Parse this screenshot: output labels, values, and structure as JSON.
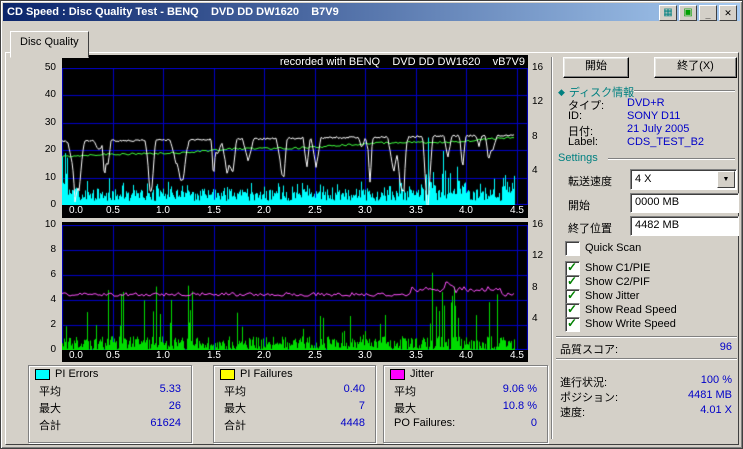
{
  "window": {
    "title": "CD Speed : Disc Quality Test - BENQ    DVD DD DW1620    B7V9"
  },
  "titlebar": {
    "chart_icon": "chart",
    "save_icon": "save",
    "minimize": "_",
    "close": "✕"
  },
  "tab": {
    "label": "Disc Quality"
  },
  "charts": {
    "header": "recorded with BENQ    DVD DD DW1620    vB7V9",
    "x_ticks": [
      "0.0",
      "0.5",
      "1.0",
      "1.5",
      "2.0",
      "2.5",
      "3.0",
      "3.5",
      "4.0",
      "4.5"
    ],
    "top": {
      "left_ticks": [
        50,
        40,
        30,
        20,
        10,
        0
      ],
      "right_ticks": [
        16,
        12,
        8,
        4
      ]
    },
    "bottom": {
      "left_ticks": [
        10,
        8,
        6,
        4,
        2,
        0
      ],
      "right_ticks": [
        16,
        12,
        8,
        4
      ]
    },
    "colors": {
      "grid": "#0000C8",
      "pie": "#00FFFF",
      "pif": "#00DC00",
      "jitter": "#FF50FF",
      "read_speed": "#FFFFFF",
      "write_speed": "#40FF40"
    }
  },
  "chart_data": [
    {
      "type": "area",
      "position": "top",
      "x_unit": "GB",
      "x_range": [
        0,
        4.6
      ],
      "x_ticks": [
        "0.0",
        "0.5",
        "1.0",
        "1.5",
        "2.0",
        "2.5",
        "3.0",
        "3.5",
        "4.0",
        "4.5"
      ],
      "left_axis": {
        "range": [
          0,
          50
        ],
        "ticks": [
          50,
          40,
          30,
          20,
          10,
          0
        ]
      },
      "right_axis": {
        "ticks": [
          16,
          12,
          8,
          4
        ]
      },
      "annotation": "recorded with BENQ    DVD DD DW1620    vB7V9",
      "series": [
        {
          "name": "PI Errors (C1/PIE)",
          "color": "#00FFFF",
          "style": "vertical-spikes",
          "average": 5.33,
          "maximum": 26,
          "total": 61624,
          "shape": "dense spikes mostly 2-8 on 0-50 scale, taller cluster up to ~26 between 3.6 and 4.0 GB, tall burst at 0 GB"
        },
        {
          "name": "Write Speed",
          "color": "#40FF40",
          "style": "line",
          "shape": "rises steadily from ~17 to ~24 on the 0-50 left scale"
        },
        {
          "name": "Read Speed",
          "color": "#FFFFFF",
          "style": "line",
          "shape": "~23-25 with frequent narrow downward dips, deepest near 3.6 GB"
        }
      ]
    },
    {
      "type": "area",
      "position": "bottom",
      "x_unit": "GB",
      "x_range": [
        0,
        4.6
      ],
      "x_ticks": [
        "0.0",
        "0.5",
        "1.0",
        "1.5",
        "2.0",
        "2.5",
        "3.0",
        "3.5",
        "4.0",
        "4.5"
      ],
      "left_axis": {
        "range": [
          0,
          10
        ],
        "ticks": [
          10,
          8,
          6,
          4,
          2,
          0
        ]
      },
      "right_axis": {
        "ticks": [
          16,
          12,
          8,
          4
        ]
      },
      "series": [
        {
          "name": "PI Failures (C2/PIF)",
          "color": "#00DC00",
          "style": "vertical-spikes",
          "average": 0.4,
          "maximum": 7,
          "total": 4448,
          "shape": "dense spikes 0-4, taller group near 0-1.3 GB and 3.5-4.1 GB reaching ~7"
        },
        {
          "name": "Jitter",
          "color": "#FF50FF",
          "style": "line",
          "average": "9.06 %",
          "maximum": "10.8 %",
          "shape": "noisy line around 4.5 on the 0-10 scale, peaks ~5.4 near 3.8 GB"
        }
      ]
    }
  ],
  "legend": {
    "pi_errors": {
      "title": "PI Errors",
      "swatch": "#00FFFF",
      "rows": [
        {
          "label": "平均",
          "value": "5.33"
        },
        {
          "label": "最大",
          "value": "26"
        },
        {
          "label": "合計",
          "value": "61624"
        }
      ]
    },
    "pi_failures": {
      "title": "PI Failures",
      "swatch": "#FFFF00",
      "rows": [
        {
          "label": "平均",
          "value": "0.40"
        },
        {
          "label": "最大",
          "value": "7"
        },
        {
          "label": "合計",
          "value": "4448"
        }
      ]
    },
    "jitter": {
      "title": "Jitter",
      "swatch": "#FF00FF",
      "rows": [
        {
          "label": "平均",
          "value": "9.06 %"
        },
        {
          "label": "最大",
          "value": "10.8 %"
        },
        {
          "label": "PO Failures:",
          "value": "0"
        }
      ]
    }
  },
  "side": {
    "start_button": "開始",
    "exit_button": "終了(X)",
    "disc_info": {
      "header": "ディスク情報",
      "rows": [
        {
          "label": "タイプ:",
          "value": "DVD+R"
        },
        {
          "label": "ID:",
          "value": "SONY D11"
        },
        {
          "label": "日付:",
          "value": "21 July 2005"
        },
        {
          "label": "Label:",
          "value": "CDS_TEST_B2"
        }
      ]
    },
    "settings": {
      "header": "Settings",
      "transfer_rate_label": "転送速度",
      "transfer_rate_value": "4 X",
      "start_label": "開始",
      "start_value": "0000 MB",
      "end_label": "終了位置",
      "end_value": "4482 MB",
      "checkboxes": [
        {
          "label": "Quick Scan",
          "checked": false
        },
        {
          "label": "Show C1/PIE",
          "checked": true
        },
        {
          "label": "Show C2/PIF",
          "checked": true
        },
        {
          "label": "Show Jitter",
          "checked": true
        },
        {
          "label": "Show Read Speed",
          "checked": true
        },
        {
          "label": "Show Write Speed",
          "checked": true
        }
      ]
    },
    "score": {
      "label": "品質スコア:",
      "value": "96"
    },
    "status": [
      {
        "label": "進行状況:",
        "value": "100 %"
      },
      {
        "label": "ポジション:",
        "value": "4481 MB"
      },
      {
        "label": "速度:",
        "value": "4.01 X"
      }
    ]
  }
}
